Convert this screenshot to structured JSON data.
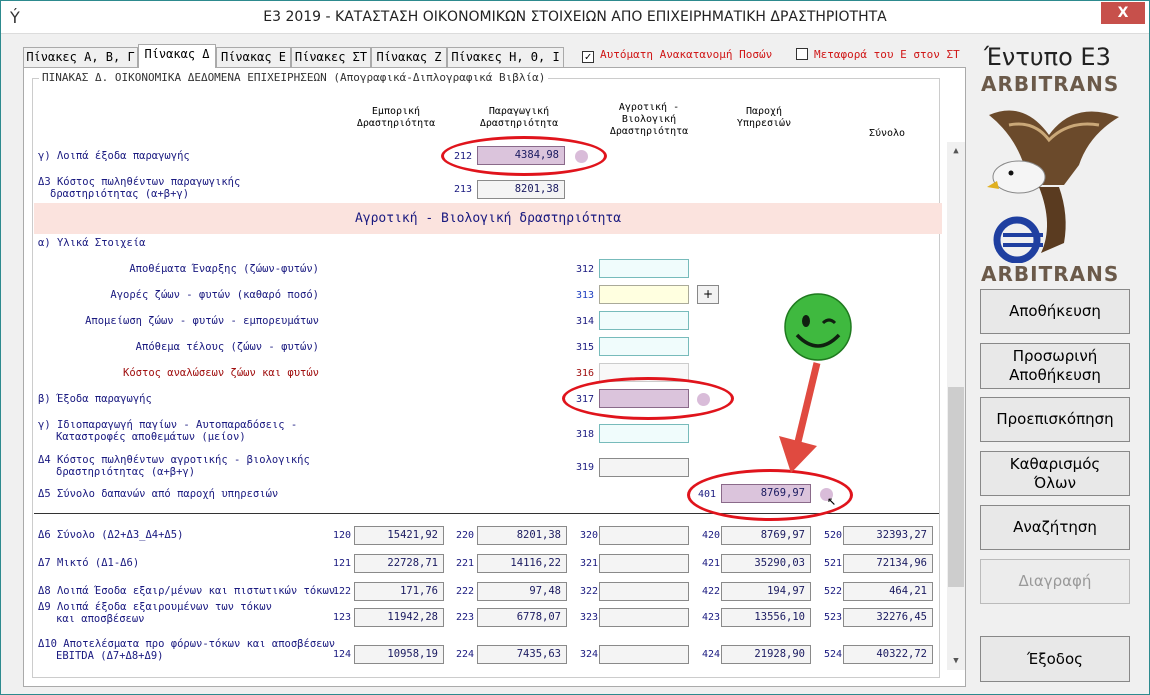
{
  "window": {
    "title": "Ε3 2019 - ΚΑΤΑΣΤΑΣΗ ΟΙΚΟΝΟΜΙΚΩΝ ΣΤΟΙΧΕΙΩΝ ΑΠΟ ΕΠΙΧΕΙΡΗΜΑΤΙΚΗ ΔΡΑΣΤΗΡΙΟΤΗΤΑ",
    "close": "X"
  },
  "tabs": [
    "Πίνακες Α, Β, Γ",
    "Πίνακας Δ",
    "Πίνακας Ε",
    "Πίνακες ΣΤ",
    "Πίνακας Ζ",
    "Πίνακες Η, Θ, Ι"
  ],
  "options": {
    "auto": "Αυτόματη Ανακατανομή Ποσών",
    "auto_checked": "✓",
    "transfer": "Μεταφορά του Ε στον ΣΤ"
  },
  "group_title": "ΠΙΝΑΚΑΣ Δ. ΟΙΚΟΝΟΜΙΚΑ ΔΕΔΟΜΕΝΑ ΕΠΙΧΕΙΡΗΣΕΩΝ (Απογραφικά-Διπλογραφικά Βιβλία)",
  "columns": {
    "c1a": "Εμπορική",
    "c1b": "Δραστηριότητα",
    "c2a": "Παραγωγική",
    "c2b": "Δραστηριότητα",
    "c3a": "Αγροτική -",
    "c3b": "Βιολογική",
    "c3c": "Δραστηριότητα",
    "c4a": "Παροχή",
    "c4b": "Υπηρεσιών",
    "c5": "Σύνολο"
  },
  "rows": {
    "r212": {
      "label": "γ) Λοιπά έξοδα παραγωγής",
      "code": "212",
      "value": "4384,98"
    },
    "r213": {
      "label1": "Δ3 Κόστος πωληθέντων παραγωγικής",
      "label2": "δραστηριότητας (α+β+γ)",
      "code": "213",
      "value": "8201,38"
    },
    "section": "Αγροτική - Βιολογική δραστηριότητα",
    "sub_a": "α) Υλικά Στοιχεία",
    "r312": {
      "label": "Αποθέματα Έναρξης (ζώων-φυτών)",
      "code": "312"
    },
    "r313": {
      "label": "Αγορές ζώων - φυτών (καθαρό ποσό)",
      "code": "313",
      "plus": "+"
    },
    "r314": {
      "label": "Απομείωση ζώων - φυτών - εμπορευμάτων",
      "code": "314"
    },
    "r315": {
      "label": "Απόθεμα τέλους (ζώων - φυτών)",
      "code": "315"
    },
    "r316": {
      "label": "Κόστος αναλώσεων ζώων και φυτών",
      "code": "316"
    },
    "r317": {
      "label": "β) Έξοδα παραγωγής",
      "code": "317"
    },
    "r318": {
      "label1": "γ) Ιδιοπαραγωγή παγίων - Αυτοπαραδόσεις -",
      "label2": "Καταστροφές αποθεμάτων (μείον)",
      "code": "318"
    },
    "r319": {
      "label1": "Δ4 Κόστος πωληθέντων αγροτικής - βιολογικής",
      "label2": "δραστηριότητας (α+β+γ)",
      "code": "319"
    },
    "r401": {
      "label": "Δ5 Σύνολο δαπανών από παροχή υπηρεσιών",
      "code": "401",
      "value": "8769,97"
    }
  },
  "totals": [
    {
      "label1": "Δ6 Σύνολο (Δ2+Δ3_Δ4+Δ5)",
      "label2": "",
      "codes": [
        "120",
        "220",
        "320",
        "420",
        "520"
      ],
      "values": [
        "15421,92",
        "8201,38",
        "",
        "8769,97",
        "32393,27"
      ]
    },
    {
      "label1": "Δ7 Μικτό (Δ1-Δ6)",
      "label2": "",
      "codes": [
        "121",
        "221",
        "321",
        "421",
        "521"
      ],
      "values": [
        "22728,71",
        "14116,22",
        "",
        "35290,03",
        "72134,96"
      ]
    },
    {
      "label1": "Δ8 Λοιπά Έσοδα εξαιρ/μένων και πιστωτικών τόκων",
      "label2": "",
      "codes": [
        "122",
        "222",
        "322",
        "422",
        "522"
      ],
      "values": [
        "171,76",
        "97,48",
        "",
        "194,97",
        "464,21"
      ]
    },
    {
      "label1": "Δ9 Λοιπά έξοδα εξαιρουμένων των τόκων",
      "label2": "και αποσβέσεων",
      "codes": [
        "123",
        "223",
        "323",
        "423",
        "523"
      ],
      "values": [
        "11942,28",
        "6778,07",
        "",
        "13556,10",
        "32276,45"
      ]
    },
    {
      "label1": "Δ10 Αποτελέσματα προ φόρων-τόκων και αποσβέσεων",
      "label2": "EBITDA (Δ7+Δ8+Δ9)",
      "codes": [
        "124",
        "224",
        "324",
        "424",
        "524"
      ],
      "values": [
        "10958,19",
        "7435,63",
        "",
        "21928,90",
        "40322,72"
      ]
    }
  ],
  "sidebar": {
    "title": "Έντυπο Ε3",
    "brand": "ARBITRANS",
    "buttons": {
      "save": "Αποθήκευση",
      "temp1": "Προσωρινή",
      "temp2": "Αποθήκευση",
      "preview": "Προεπισκόπηση",
      "clear1": "Καθαρισμός",
      "clear2": "Όλων",
      "search": "Αναζήτηση",
      "delete": "Διαγραφή",
      "exit": "Έξοδος"
    }
  },
  "scroll": {
    "up": "▲",
    "down": "▼"
  },
  "colors": {
    "accent": "#e0141c",
    "label": "#1a1a80",
    "section": "#fbe3de",
    "highlight": "#dbc4dc"
  },
  "icons": [
    "app-bird-icon",
    "eagle-logo-icon",
    "smiley-icon",
    "arrow-icon",
    "cursor-icon"
  ]
}
